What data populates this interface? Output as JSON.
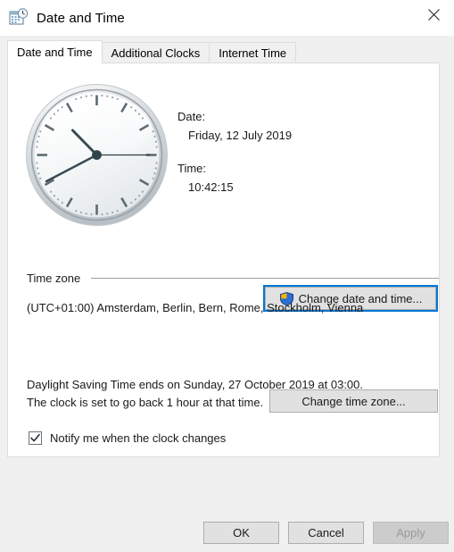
{
  "window": {
    "title": "Date and Time",
    "icon": "calendar-clock-icon",
    "close_label": "✕"
  },
  "tabs": [
    {
      "label": "Date and Time",
      "active": true
    },
    {
      "label": "Additional Clocks",
      "active": false
    },
    {
      "label": "Internet Time",
      "active": false
    }
  ],
  "main": {
    "clock": {
      "hour": 10,
      "minute": 42,
      "second": 15,
      "face_color": "#f4f6f7",
      "bezel_color": "#c9ced3",
      "hand_color": "#3a4a52"
    },
    "date_label": "Date:",
    "date_value": "Friday, 12 July 2019",
    "time_label": "Time:",
    "time_value": "10:42:15",
    "change_date_time_button": "Change date and time...",
    "change_date_time_icon": "uac-shield-icon",
    "timezone_group_label": "Time zone",
    "timezone_value": "(UTC+01:00) Amsterdam, Berlin, Bern, Rome, Stockholm, Vienna",
    "change_timezone_button": "Change time zone...",
    "dst_line1": "Daylight Saving Time ends on Sunday, 27 October 2019 at 03:00.",
    "dst_line2": "The clock is set to go back 1 hour at that time.",
    "notify_checkbox_label": "Notify me when the clock changes",
    "notify_checkbox_checked": true
  },
  "footer": {
    "ok_label": "OK",
    "cancel_label": "Cancel",
    "apply_label": "Apply",
    "apply_disabled": true
  },
  "colors": {
    "accent": "#0078d7",
    "dialog_bg": "#f0f0f0",
    "panel_bg": "#ffffff",
    "button_bg": "#e1e1e1",
    "button_border": "#adadad",
    "disabled_text": "#999999"
  }
}
